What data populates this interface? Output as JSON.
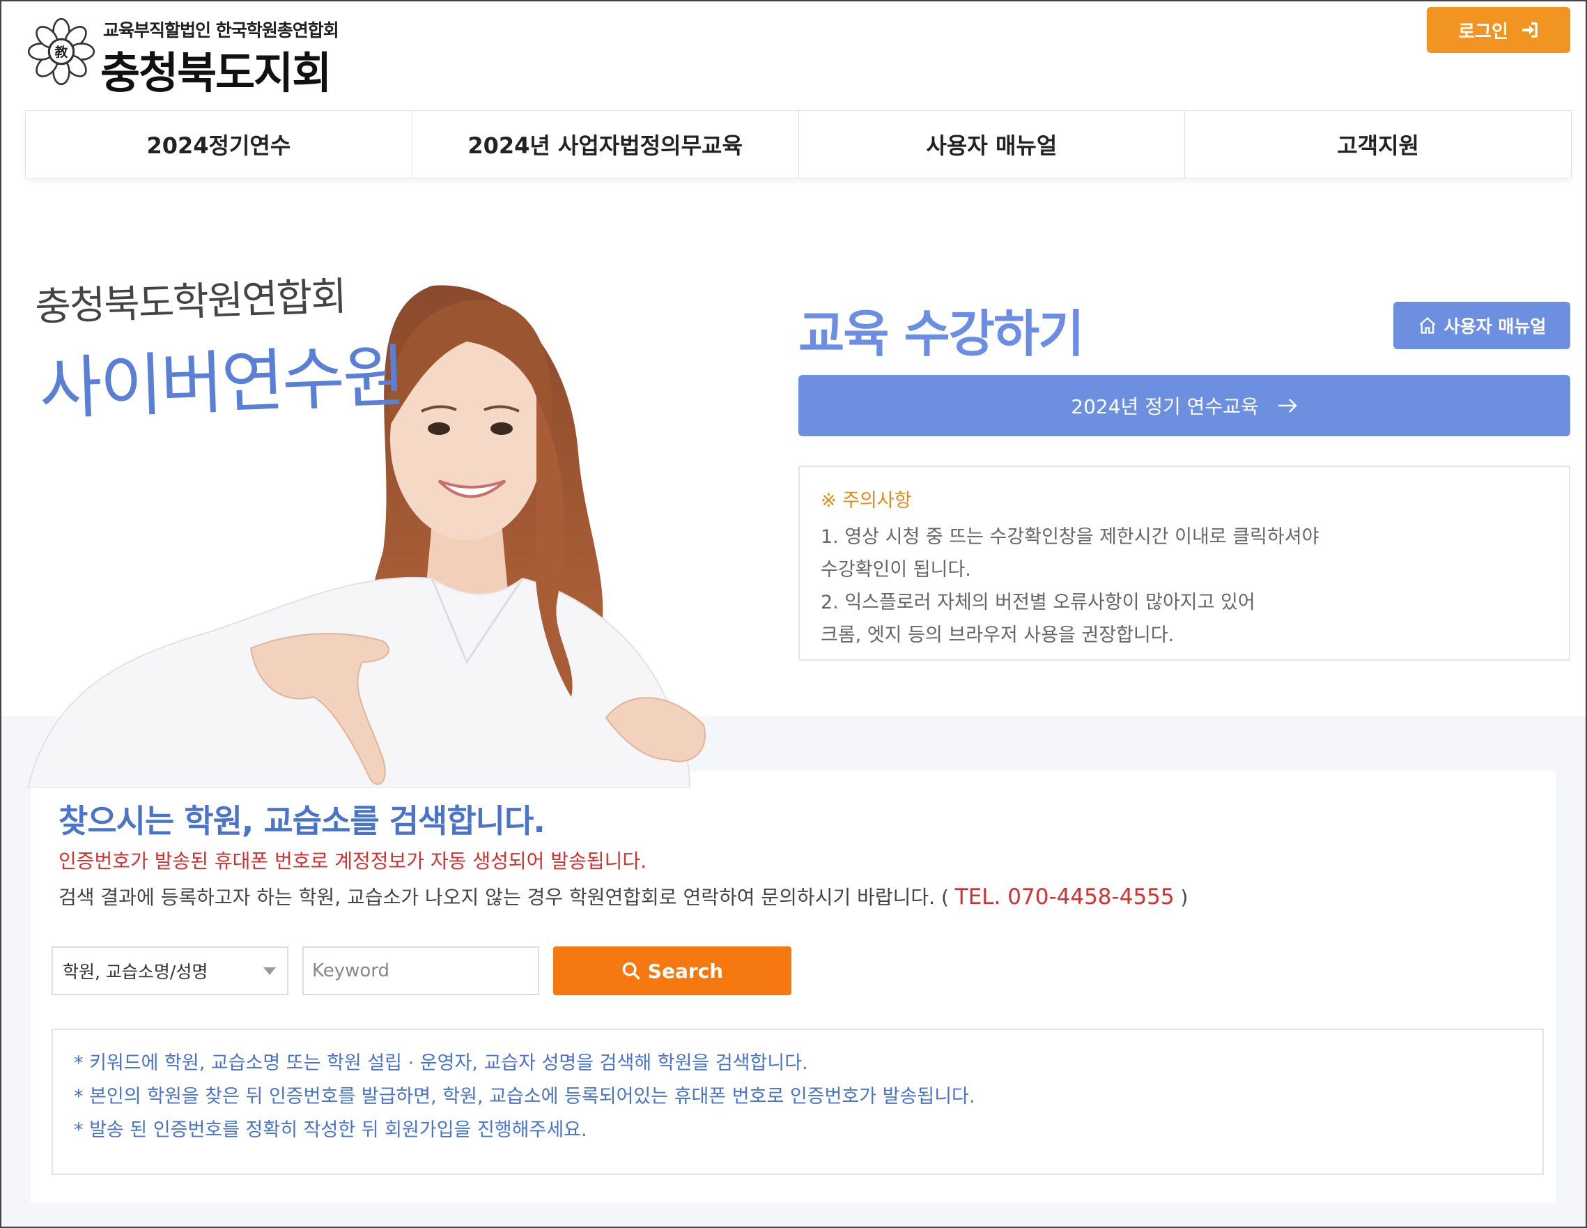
{
  "header": {
    "logo_sub": "교육부직할법인 한국학원총연합회",
    "logo_main": "충청북도지회",
    "emblem_text": "教",
    "login_label": "로그인"
  },
  "nav": {
    "items": [
      {
        "label": "2024정기연수"
      },
      {
        "label": "2024년 사업자법정의무교육"
      },
      {
        "label": "사용자 매뉴얼"
      },
      {
        "label": "고객지원"
      }
    ]
  },
  "hero": {
    "subtitle": "충청북도학원연합회",
    "title": "사이버연수원"
  },
  "education": {
    "title": "교육 수강하기",
    "manual_button": "사용자 매뉴얼",
    "course_button": "2024년 정기 연수교육",
    "notice": {
      "title": "※ 주의사항",
      "lines": [
        "1. 영상 시청 중 뜨는 수강확인창을 제한시간 이내로 클릭하셔야",
        "수강확인이 됩니다.",
        "2. 익스플로러 자체의 버전별 오류사항이 많아지고 있어",
        "크롬, 엣지 등의 브라우저 사용을 권장합니다."
      ]
    }
  },
  "search": {
    "title": "찾으시는 학원, 교습소를 검색합니다.",
    "red_notice": "인증번호가 발송된 휴대폰 번호로 계정정보가 자동 생성되어 발송됩니다.",
    "gray_notice": "검색 결과에 등록하고자 하는 학원, 교습소가 나오지 않는 경우 학원연합회로 연락하여 문의하시기 바랍니다. (",
    "tel": "TEL. 070-4458-4555",
    "tel_close": ")",
    "select_value": "학원, 교습소명/성명",
    "keyword_placeholder": "Keyword",
    "button_label": "Search",
    "info_lines": [
      "* 키워드에 학원, 교습소명 또는 학원 설립 · 운영자, 교습자 성명을 검색해 학원을 검색합니다.",
      "* 본인의 학원을 찾은 뒤 인증번호를 발급하면, 학원, 교습소에 등록되어있는 휴대폰 번호로 인증번호가 발송됩니다.",
      "* 발송 된 인증번호를 정확히 작성한 뒤 회원가입을 진행해주세요."
    ]
  },
  "colors": {
    "accent_blue": "#6d8fe0",
    "login_orange": "#f29422",
    "search_orange": "#f57810",
    "notice_red": "#d23131"
  }
}
